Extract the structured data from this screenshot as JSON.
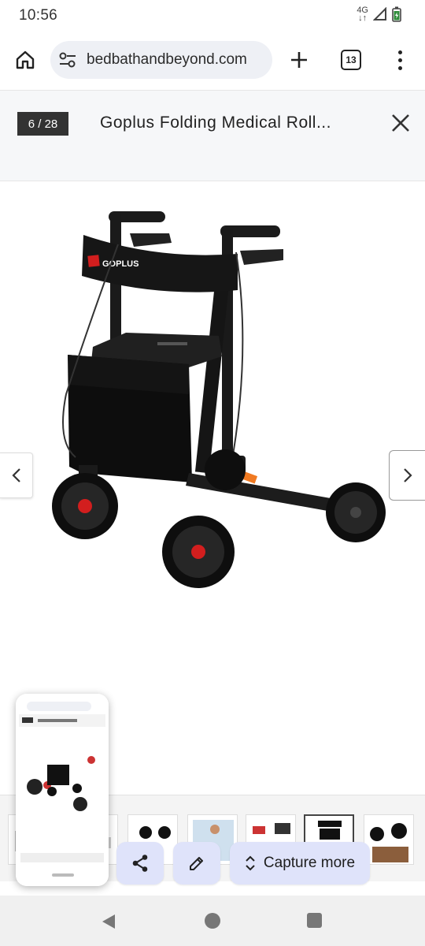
{
  "status_bar": {
    "time": "10:56",
    "network": "4G",
    "icons": [
      "signal-icon",
      "battery-icon"
    ]
  },
  "browser": {
    "url": "bedbathandbeyond.com",
    "tab_count": "13",
    "icons": [
      "home-icon",
      "site-info-icon",
      "new-tab-icon",
      "tabs-icon",
      "more-menu-icon"
    ]
  },
  "gallery": {
    "counter": "6 / 28",
    "current_index": 6,
    "total": 28,
    "title": "Goplus Folding Medical Roll...",
    "brand_on_product": "GOPLUS",
    "icons": [
      "close-icon",
      "chevron-left-icon",
      "chevron-right-icon"
    ]
  },
  "capture_bar": {
    "capture_more_label": "Capture more",
    "icons": [
      "share-icon",
      "edit-icon",
      "expand-icon"
    ]
  },
  "preview": {
    "title_text": "Goplus Folding Medical Roll"
  },
  "colors": {
    "accent_button": "#dfe3fa",
    "counter_badge": "#333333",
    "brand_red": "#d21e1e",
    "lever_orange": "#f07a22"
  }
}
